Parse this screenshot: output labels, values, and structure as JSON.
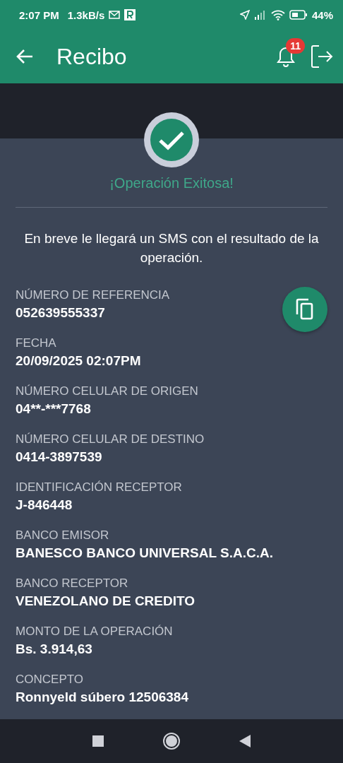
{
  "status_bar": {
    "time": "2:07 PM",
    "speed": "1.3kB/s",
    "battery": "44%"
  },
  "app_bar": {
    "title": "Recibo",
    "notification_count": "11"
  },
  "result": {
    "title": "¡Operación Exitosa!",
    "message": "En breve le llegará un SMS con el resultado de la operación."
  },
  "fields": [
    {
      "label": "NÚMERO DE REFERENCIA",
      "value": "052639555337"
    },
    {
      "label": "FECHA",
      "value": "20/09/2025 02:07PM"
    },
    {
      "label": "NÚMERO CELULAR DE ORIGEN",
      "value": "04**-***7768"
    },
    {
      "label": "NÚMERO CELULAR DE DESTINO",
      "value": "0414-3897539"
    },
    {
      "label": "IDENTIFICACIÓN RECEPTOR",
      "value": "J-846448"
    },
    {
      "label": "BANCO EMISOR",
      "value": "BANESCO BANCO UNIVERSAL S.A.C.A."
    },
    {
      "label": "BANCO RECEPTOR",
      "value": "VENEZOLANO DE CREDITO"
    },
    {
      "label": "MONTO DE LA OPERACIÓN",
      "value": "Bs. 3.914,63"
    },
    {
      "label": "CONCEPTO",
      "value": "Ronnyeld súbero 12506384"
    }
  ]
}
